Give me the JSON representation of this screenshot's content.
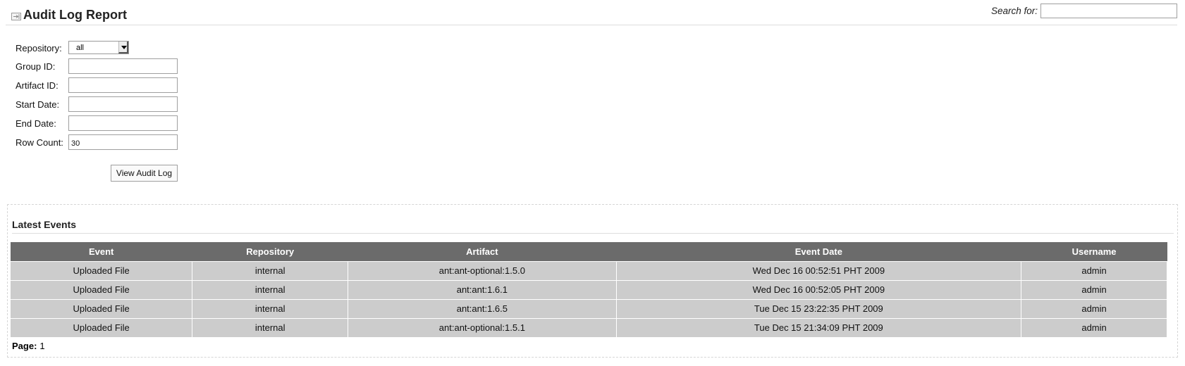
{
  "header": {
    "title": "Audit Log Report",
    "icon": "collapse-toggle-icon",
    "search_label": "Search for:",
    "search_value": ""
  },
  "form": {
    "repository_label": "Repository:",
    "repository_value": "all",
    "group_id_label": "Group ID:",
    "group_id_value": "",
    "artifact_id_label": "Artifact ID:",
    "artifact_id_value": "",
    "start_date_label": "Start Date:",
    "start_date_value": "",
    "end_date_label": "End Date:",
    "end_date_value": "",
    "row_count_label": "Row Count:",
    "row_count_value": "30",
    "submit_label": "View Audit Log"
  },
  "events": {
    "title": "Latest Events",
    "columns": [
      "Event",
      "Repository",
      "Artifact",
      "Event Date",
      "Username"
    ],
    "rows": [
      [
        "Uploaded File",
        "internal",
        "ant:ant-optional:1.5.0",
        "Wed Dec 16 00:52:51 PHT 2009",
        "admin"
      ],
      [
        "Uploaded File",
        "internal",
        "ant:ant:1.6.1",
        "Wed Dec 16 00:52:05 PHT 2009",
        "admin"
      ],
      [
        "Uploaded File",
        "internal",
        "ant:ant:1.6.5",
        "Tue Dec 15 23:22:35 PHT 2009",
        "admin"
      ],
      [
        "Uploaded File",
        "internal",
        "ant:ant-optional:1.5.1",
        "Tue Dec 15 21:34:09 PHT 2009",
        "admin"
      ]
    ],
    "page_label": "Page:",
    "page_value": "1"
  },
  "colors": {
    "table_header_bg": "#6b6b6b",
    "table_row_bg": "#cccccc",
    "divider": "#dddddd"
  }
}
